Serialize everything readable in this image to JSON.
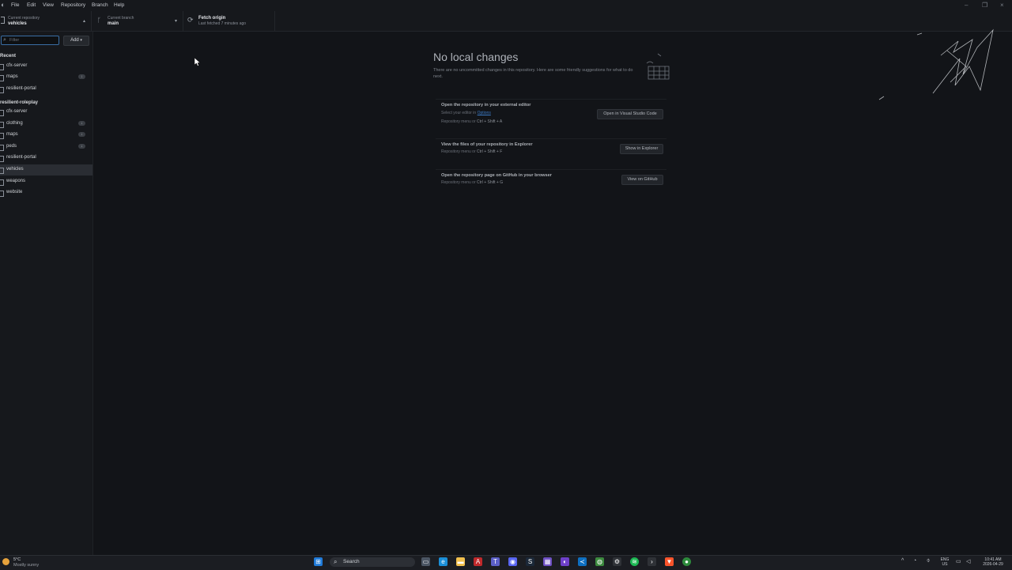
{
  "menubar": {
    "items": [
      "File",
      "Edit",
      "View",
      "Repository",
      "Branch",
      "Help"
    ]
  },
  "toolbar": {
    "repo_label": "Current repository",
    "repo_value": "vehicles",
    "branch_label": "Current branch",
    "branch_value": "main",
    "fetch_title": "Fetch origin",
    "fetch_sub": "Last fetched 7 minutes ago"
  },
  "sidebar": {
    "filter_placeholder": "Filter",
    "add_label": "Add",
    "groups": [
      {
        "title": "Recent",
        "repos": [
          {
            "name": "cfx-server",
            "badge": false
          },
          {
            "name": "maps",
            "badge": true
          },
          {
            "name": "resilient-portal",
            "badge": false
          }
        ]
      },
      {
        "title": "resilient-roleplay",
        "repos": [
          {
            "name": "cfx-server",
            "badge": false
          },
          {
            "name": "clothing",
            "badge": true
          },
          {
            "name": "maps",
            "badge": true
          },
          {
            "name": "peds",
            "badge": true
          },
          {
            "name": "resilient-portal",
            "badge": false
          },
          {
            "name": "vehicles",
            "badge": false,
            "selected": true
          },
          {
            "name": "weapons",
            "badge": false
          },
          {
            "name": "website",
            "badge": false
          }
        ]
      }
    ]
  },
  "main": {
    "title": "No local changes",
    "subtitle": "There are no uncommitted changes in this repository. Here are some friendly suggestions for what to do next.",
    "cards": [
      {
        "title": "Open the repository in your external editor",
        "line1_prefix": "Select your editor in ",
        "line1_link": "Options",
        "shortcut_prefix": "Repository menu or ",
        "shortcut": "Ctrl + Shift + A",
        "button": "Open in Visual Studio Code"
      },
      {
        "title": "View the files of your repository in Explorer",
        "shortcut_prefix": "Repository menu or ",
        "shortcut": "Ctrl + Shift + F",
        "button": "Show in Explorer"
      },
      {
        "title": "Open the repository page on GitHub in your browser",
        "shortcut_prefix": "Repository menu or ",
        "shortcut": "Ctrl + Shift + G",
        "button": "View on GitHub"
      }
    ]
  },
  "taskbar": {
    "weather_temp": "5°C",
    "weather_desc": "Mostly sunny",
    "search_label": "Search",
    "lang_1": "ENG",
    "lang_2": "US",
    "time": "10:41 AM",
    "date": "2026-04-29"
  },
  "colors": {
    "background": "#121418",
    "accent_blue": "#3b79c4"
  }
}
